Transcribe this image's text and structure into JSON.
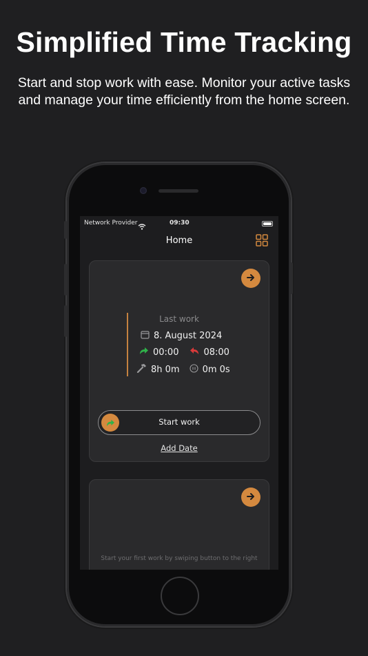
{
  "headline": "Simplified Time Tracking",
  "subline": "Start and stop work with ease. Monitor your active tasks and manage your time efficiently from the home screen.",
  "status_bar": {
    "carrier": "Network Provider",
    "time": "09:30"
  },
  "nav": {
    "title": "Home",
    "grid_icon": "grid-icon"
  },
  "last_work": {
    "label": "Last work",
    "date": "8. August 2024",
    "start_time": "00:00",
    "end_time": "08:00",
    "worked": "8h 0m",
    "pause": "0m 0s"
  },
  "start_button_label": "Start work",
  "add_date_label": "Add Date",
  "hint_text": "Start your first work by swiping button to the right",
  "colors": {
    "accent": "#d4893f",
    "green": "#2fb24a",
    "red": "#d93a3a",
    "background": "#1f1f21"
  }
}
